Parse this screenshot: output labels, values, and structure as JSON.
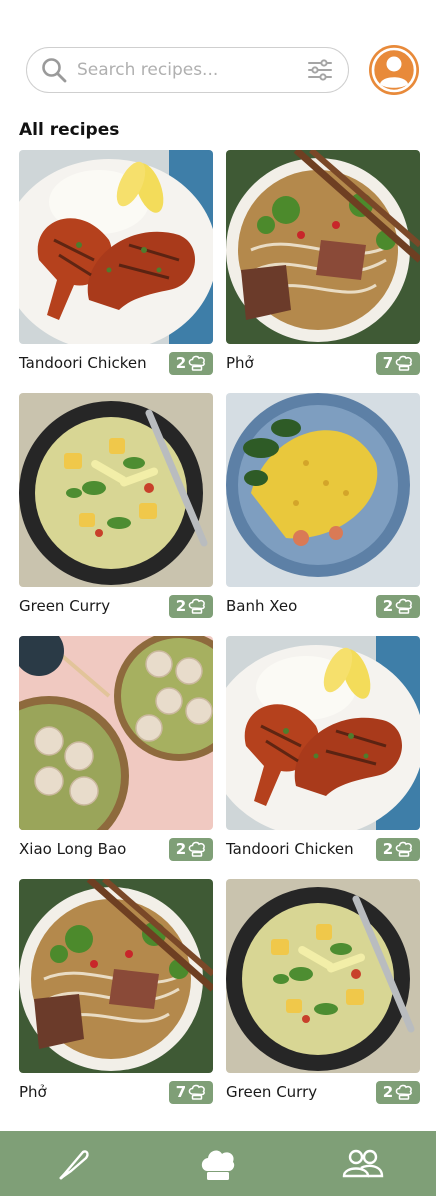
{
  "search": {
    "placeholder": "Search recipes...",
    "icon": "search-icon",
    "filter_icon": "sliders-icon"
  },
  "profile": {
    "icon": "user-icon",
    "color": "#e88a3a"
  },
  "section_title": "All recipes",
  "colors": {
    "accent": "#7f9f77",
    "avatar": "#e88a3a"
  },
  "recipes": [
    {
      "name": "Tandoori Chicken",
      "count": "2",
      "image": "tandoori-chicken"
    },
    {
      "name": "Phở",
      "count": "7",
      "image": "pho"
    },
    {
      "name": "Green Curry",
      "count": "2",
      "image": "green-curry"
    },
    {
      "name": "Banh Xeo",
      "count": "2",
      "image": "banh-xeo"
    },
    {
      "name": "Xiao Long Bao",
      "count": "2",
      "image": "xiao-long-bao"
    },
    {
      "name": "Tandoori Chicken",
      "count": "2",
      "image": "tandoori-chicken"
    },
    {
      "name": "Phở",
      "count": "7",
      "image": "pho"
    },
    {
      "name": "Green Curry",
      "count": "2",
      "image": "green-curry"
    }
  ],
  "nav": [
    {
      "name": "knife",
      "icon": "knife-icon"
    },
    {
      "name": "chef-hat",
      "icon": "chef-hat-icon"
    },
    {
      "name": "community",
      "icon": "users-icon"
    }
  ]
}
